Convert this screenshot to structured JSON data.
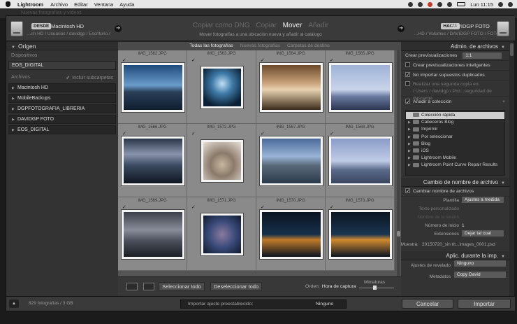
{
  "menubar": {
    "app": "Lightroom",
    "items": [
      "Archivo",
      "Editar",
      "Ventana",
      "Ayuda"
    ],
    "clock": "Lun 11:15"
  },
  "behind": {
    "text": "Nuevas fotografías y vídeos"
  },
  "topbar": {
    "source_tag": "DESDE",
    "source_name": "Macintosh HD",
    "source_path": "...ch HD / Usuarios / davidgp / Escritorio /",
    "modes": [
      "Copiar como DNG",
      "Copiar",
      "Mover",
      "Añadir"
    ],
    "active_mode": "Mover",
    "mode_description": "Mover fotografías a una ubicación nueva y añadir al catálogo",
    "dest_tag": "HACIA",
    "dest_name": "DAVIDGP FOTO",
    "dest_path": "...HD / Volumes / DAVIDGP FOTO / FOTOS"
  },
  "left": {
    "title": "Origen",
    "devices_label": "Dispositivos",
    "devices": [
      "EOS_DIGITAL"
    ],
    "files_label": "Archivos",
    "include_sub": "Incluir subcarpetas",
    "volumes": [
      "Macintosh HD",
      "MobileBackups",
      "DGPFOTOGRAFIA_LIBRERIA",
      "DAVIDGP FOTO",
      "EOS_DIGITAL"
    ]
  },
  "center": {
    "tabs": [
      "Todas las fotografías",
      "Nuevas fotografías",
      "Carpetas de destino"
    ],
    "photos": [
      {
        "name": "IMG_1562.JPG"
      },
      {
        "name": "IMG_1563.JPG"
      },
      {
        "name": "IMG_1564.JPG"
      },
      {
        "name": "IMG_1565.JPG"
      },
      {
        "name": "IMG_1566.JPG"
      },
      {
        "name": "IMG_1572.JPG"
      },
      {
        "name": "IMG_1567.JPG"
      },
      {
        "name": "IMG_1568.JPG"
      },
      {
        "name": "IMG_1569.JPG"
      },
      {
        "name": "IMG_1571.JPG"
      },
      {
        "name": "IMG_1570.JPG"
      },
      {
        "name": "IMG_1573.JPG"
      }
    ],
    "select_all": "Seleccionar todo",
    "deselect_all": "Deseleccionar todo",
    "order_label": "Orden:",
    "order_value": "Hora de captura",
    "thumbs_label": "Miniaturas"
  },
  "right": {
    "file_handling": {
      "title": "Admin. de archivos",
      "previews_label": "Crear previsualizaciones",
      "previews_value": "1:1",
      "smart_previews": "Crear previsualizaciones inteligentes",
      "no_duplicates": "No importar supuestos duplicados",
      "second_copy": "Realizar una segunda copia en:",
      "second_copy_path": "/ Users / davidgp / Pict...seguridad de descarga",
      "add_collection": "Añadir a colección",
      "collections": [
        "Colección rápida",
        "Cabeceros Blog",
        "Imprimir",
        "Por seleccionar",
        "Blog",
        "iOS",
        "Lightroom Mobile",
        "Lightroom Point Curve Repair Results"
      ]
    },
    "rename": {
      "title": "Cambio de nombre de archivo",
      "rename_files": "Cambiar nombre de archivos",
      "template_label": "Plantilla",
      "template_value": "Ajustes a medida",
      "custom_text_label": "Texto personalizado",
      "shoot_name_label": "Nombre de la sesión",
      "start_number_label": "Número de inicio",
      "start_number_value": "1",
      "extensions_label": "Extensiones",
      "extensions_value": "Dejar tal cual",
      "sample_label": "Muestra:",
      "sample_value": "20150720_sin tít...images_0001.psd"
    },
    "apply": {
      "title": "Aplic. durante la imp.",
      "develop_label": "Ajustes de revelado",
      "develop_value": "Ninguno",
      "metadata_label": "Metadatos",
      "metadata_value": "Copy David"
    }
  },
  "bottombar": {
    "count": "829 fotografías / 3 GB",
    "preset_label": "Importar ajuste preestablecido:",
    "preset_value": "Ninguno",
    "cancel": "Cancelar",
    "import": "Importar"
  }
}
